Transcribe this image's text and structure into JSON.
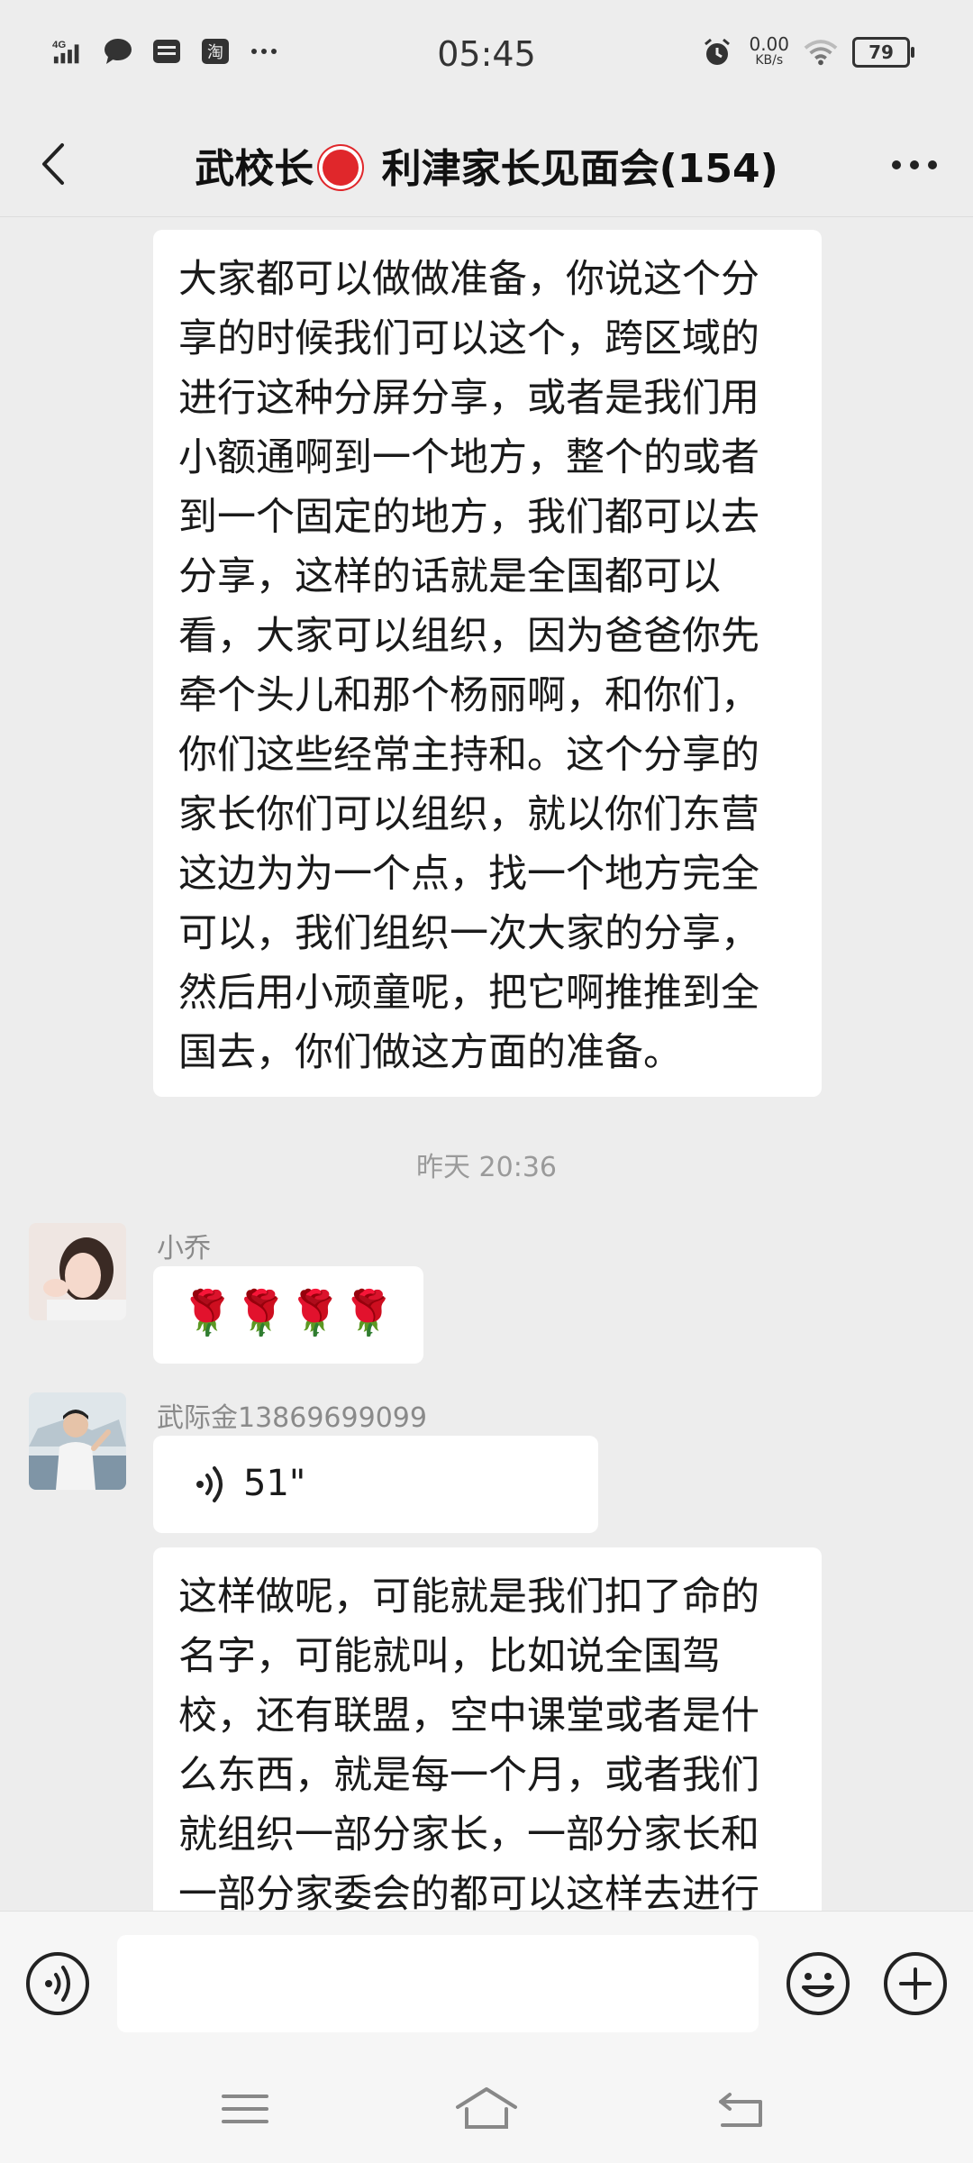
{
  "status_bar": {
    "network": "4G",
    "time": "05:45",
    "net_speed": "0.00",
    "net_speed_unit": "KB/s",
    "battery": "79"
  },
  "header": {
    "title_before": "武校长",
    "title_after": " 利津家长见面会(154)"
  },
  "messages": [
    {
      "type": "text",
      "text": "大家都可以做做准备，你说这个分享的时候我们可以这个，跨区域的进行这种分屏分享，或者是我们用小额通啊到一个地方，整个的或者到一个固定的地方，我们都可以去分享，这样的话就是全国都可以看，大家可以组织，因为爸爸你先牵个头儿和那个杨丽啊，和你们，你们这些经常主持和。这个分享的家长你们可以组织，就以你们东营这边为为一个点，找一个地方完全可以，我们组织一次大家的分享，然后用小顽童呢，把它啊推推到全国去，你们做这方面的准备。"
    },
    {
      "type": "timestamp",
      "text": "昨天 20:36"
    },
    {
      "type": "text",
      "sender": "小乔",
      "text": "🌹🌹🌹🌹"
    },
    {
      "type": "voice",
      "sender": "武际金13869699099",
      "duration": "51\""
    },
    {
      "type": "text",
      "text": "这样做呢，可能就是我们扣了命的名字，可能就叫，比如说全国驾校，还有联盟，空中课堂或者是什么东西，就是每一个月，或者我们就组织一部分家长，一部分家长和一部分家委会的都可以这样去进行这样"
    }
  ],
  "input_bar": {
    "placeholder": ""
  },
  "icons": {
    "back": "back-arrow-icon",
    "more": "more-dots-icon",
    "voice": "voice-icon",
    "emoji": "emoji-icon",
    "plus": "plus-icon",
    "nav_menu": "menu-icon",
    "nav_home": "home-icon",
    "nav_back": "back-icon"
  }
}
